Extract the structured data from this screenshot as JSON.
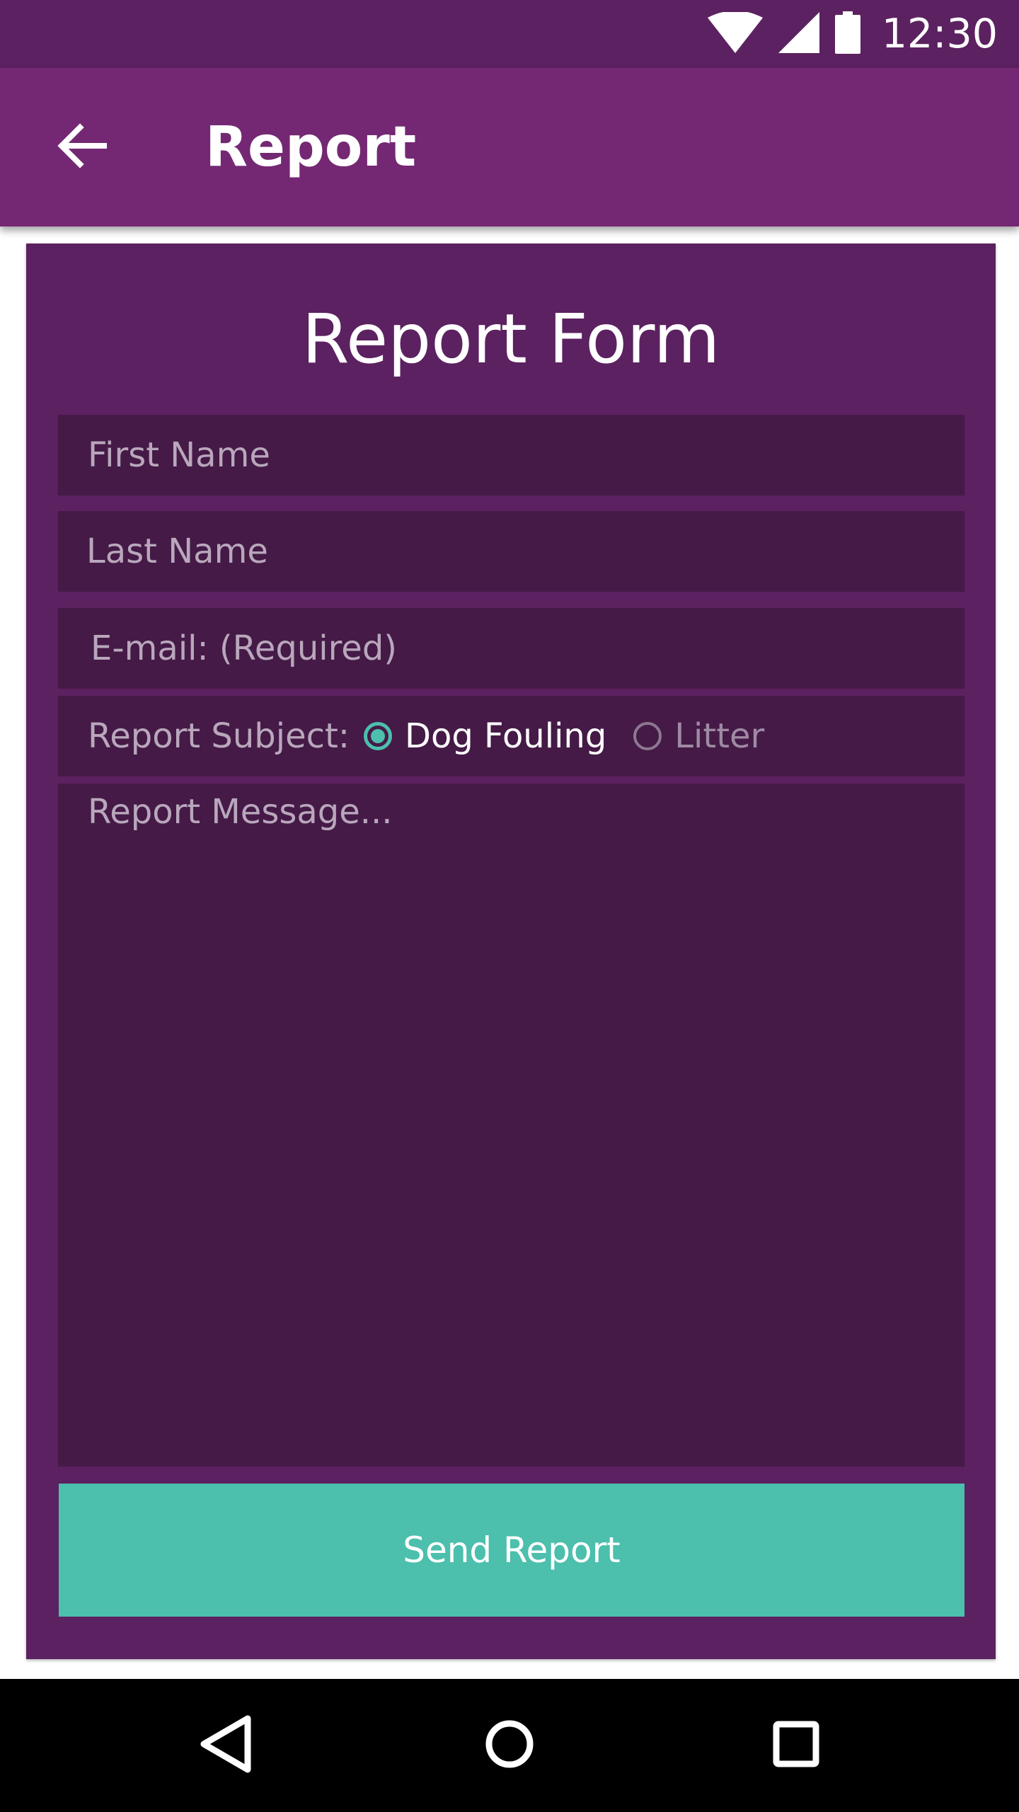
{
  "status_bar": {
    "time": "12:30",
    "icons": [
      "wifi-icon",
      "cell-signal-icon",
      "battery-icon"
    ]
  },
  "app_bar": {
    "title": "Report",
    "back_icon": "arrow-left-icon"
  },
  "form": {
    "title": "Report Form",
    "first_name_placeholder": "First Name",
    "last_name_placeholder": "Last Name",
    "email_placeholder": "E-mail: (Required)",
    "subject_label": "Report Subject:",
    "subject_options": [
      {
        "label": "Dog Fouling",
        "selected": true
      },
      {
        "label": "Litter",
        "selected": false
      }
    ],
    "message_placeholder": "Report Message...",
    "send_label": "Send Report"
  },
  "nav_bar": {
    "buttons": [
      "nav-back-icon",
      "nav-home-icon",
      "nav-recents-icon"
    ]
  },
  "colors": {
    "status_bar": "#5c2160",
    "app_bar": "#742873",
    "card": "#5c2160",
    "field": "#451a47",
    "accent": "#4cbfad"
  }
}
